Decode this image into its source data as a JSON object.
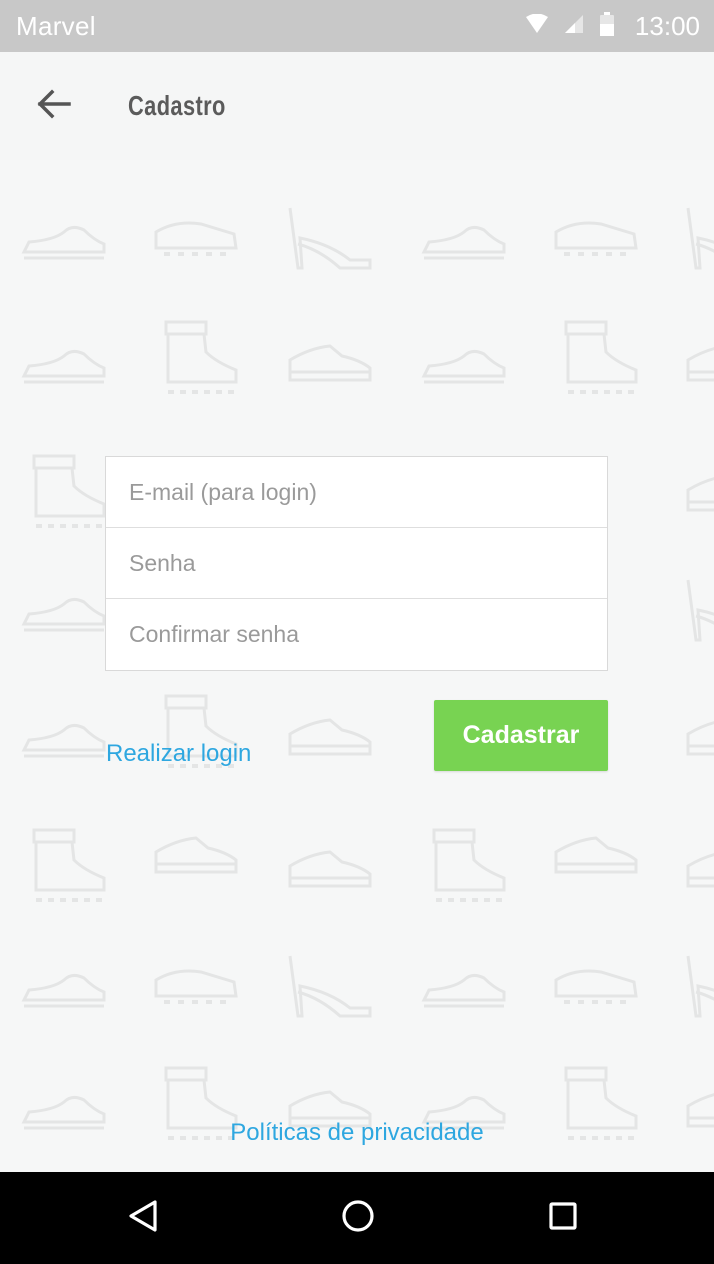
{
  "status_bar": {
    "carrier": "Marvel",
    "time": "13:00",
    "icons": [
      "wifi-icon",
      "signal-icon",
      "battery-icon"
    ]
  },
  "app_bar": {
    "title": "Cadastro",
    "back_icon": "arrow-left-icon"
  },
  "form": {
    "fields": [
      {
        "name": "email",
        "placeholder": "E-mail (para login)",
        "value": ""
      },
      {
        "name": "password",
        "placeholder": "Senha",
        "value": ""
      },
      {
        "name": "confirm_password",
        "placeholder": "Confirmar senha",
        "value": ""
      }
    ],
    "login_link": "Realizar login",
    "submit_label": "Cadastrar"
  },
  "footer": {
    "privacy_link": "Políticas de privacidade"
  },
  "nav_bar": {
    "icons": [
      "back-triangle-icon",
      "home-circle-icon",
      "recents-square-icon"
    ]
  },
  "colors": {
    "accent_green": "#78d352",
    "link_blue": "#2ea7e0",
    "status_bar": "#c8c8c8",
    "background": "#f6f7f7",
    "pattern_stroke": "#e7e8e8"
  },
  "background_pattern": {
    "icon": "shoe-pattern-icon"
  }
}
